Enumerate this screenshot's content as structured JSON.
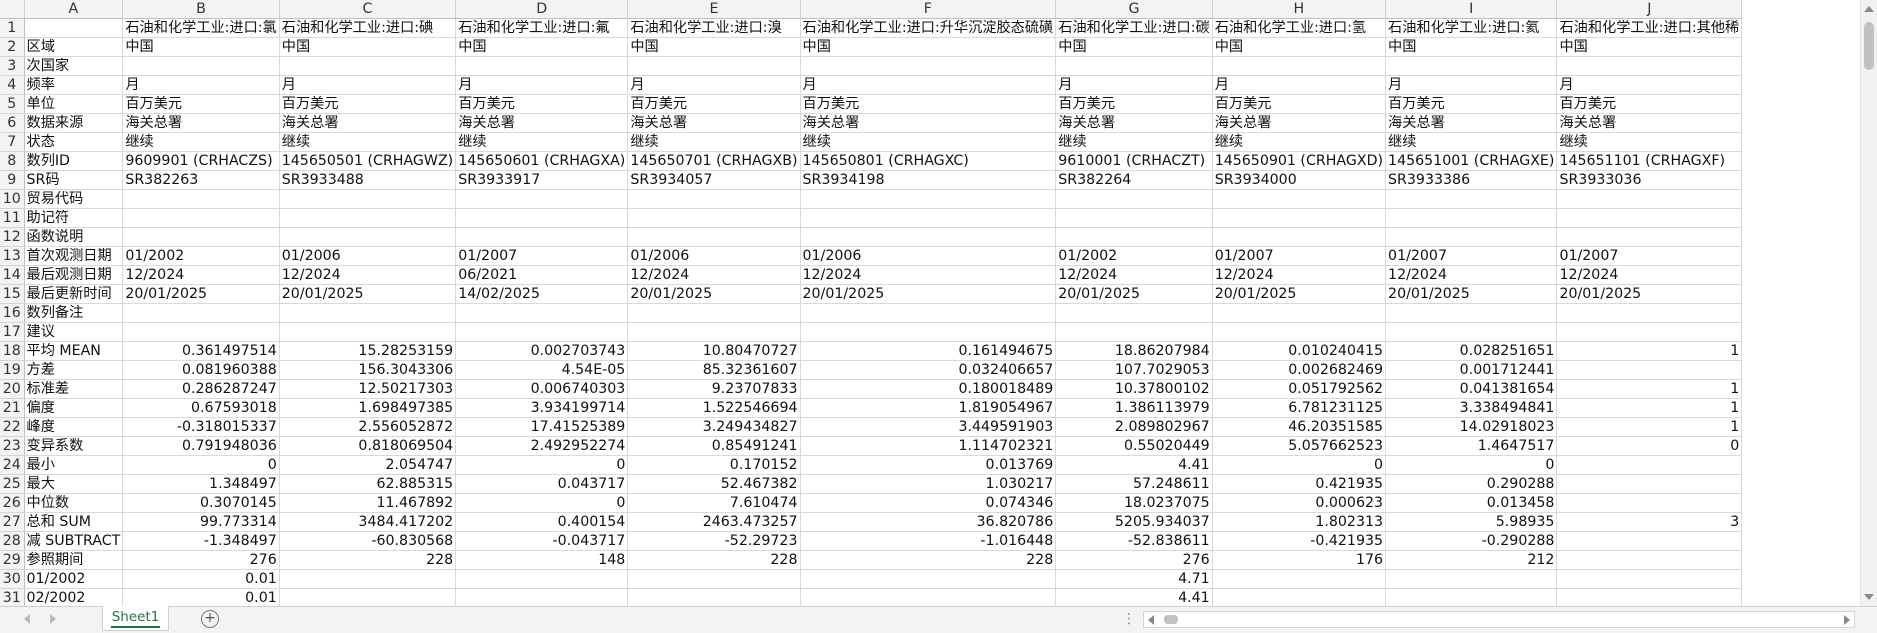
{
  "columns": [
    "A",
    "B",
    "C",
    "D",
    "E",
    "F",
    "G",
    "H",
    "I",
    "J"
  ],
  "rows": [
    {
      "n": "1",
      "cells": [
        "",
        "石油和化学工业:进口:氯",
        "石油和化学工业:进口:碘",
        "石油和化学工业:进口:氟",
        "石油和化学工业:进口:溴",
        "石油和化学工业:进口:升华沉淀胶态硫磺",
        "石油和化学工业:进口:碳",
        "石油和化学工业:进口:氢",
        "石油和化学工业:进口:氦",
        "石油和化学工业:进口:其他稀"
      ]
    },
    {
      "n": "2",
      "cells": [
        "区域",
        "中国",
        "中国",
        "中国",
        "中国",
        "中国",
        "中国",
        "中国",
        "中国",
        "中国"
      ]
    },
    {
      "n": "3",
      "cells": [
        "次国家",
        "",
        "",
        "",
        "",
        "",
        "",
        "",
        "",
        ""
      ]
    },
    {
      "n": "4",
      "cells": [
        "频率",
        "月",
        "月",
        "月",
        "月",
        "月",
        "月",
        "月",
        "月",
        "月"
      ]
    },
    {
      "n": "5",
      "cells": [
        "单位",
        "百万美元",
        "百万美元",
        "百万美元",
        "百万美元",
        "百万美元",
        "百万美元",
        "百万美元",
        "百万美元",
        "百万美元"
      ]
    },
    {
      "n": "6",
      "cells": [
        "数据来源",
        "海关总署",
        "海关总署",
        "海关总署",
        "海关总署",
        "海关总署",
        "海关总署",
        "海关总署",
        "海关总署",
        "海关总署"
      ]
    },
    {
      "n": "7",
      "cells": [
        "状态",
        "继续",
        "继续",
        "继续",
        "继续",
        "继续",
        "继续",
        "继续",
        "继续",
        "继续"
      ]
    },
    {
      "n": "8",
      "cells": [
        "数列ID",
        "9609901 (CRHACZS)",
        "145650501 (CRHAGWZ)",
        "145650601 (CRHAGXA)",
        "145650701 (CRHAGXB)",
        "145650801 (CRHAGXC)",
        "9610001 (CRHACZT)",
        "145650901 (CRHAGXD)",
        "145651001 (CRHAGXE)",
        "145651101 (CRHAGXF)"
      ]
    },
    {
      "n": "9",
      "cells": [
        "SR码",
        "SR382263",
        "SR3933488",
        "SR3933917",
        "SR3934057",
        "SR3934198",
        "SR382264",
        "SR3934000",
        "SR3933386",
        "SR3933036"
      ]
    },
    {
      "n": "10",
      "cells": [
        "贸易代码",
        "",
        "",
        "",
        "",
        "",
        "",
        "",
        "",
        ""
      ]
    },
    {
      "n": "11",
      "cells": [
        "助记符",
        "",
        "",
        "",
        "",
        "",
        "",
        "",
        "",
        ""
      ]
    },
    {
      "n": "12",
      "cells": [
        "函数说明",
        "",
        "",
        "",
        "",
        "",
        "",
        "",
        "",
        ""
      ]
    },
    {
      "n": "13",
      "cells": [
        "首次观测日期",
        "01/2002",
        "01/2006",
        "01/2007",
        "01/2006",
        "01/2006",
        "01/2002",
        "01/2007",
        "01/2007",
        "01/2007"
      ]
    },
    {
      "n": "14",
      "cells": [
        "最后观测日期",
        "12/2024",
        "12/2024",
        "06/2021",
        "12/2024",
        "12/2024",
        "12/2024",
        "12/2024",
        "12/2024",
        "12/2024"
      ]
    },
    {
      "n": "15",
      "cells": [
        "最后更新时间",
        "20/01/2025",
        "20/01/2025",
        "14/02/2025",
        "20/01/2025",
        "20/01/2025",
        "20/01/2025",
        "20/01/2025",
        "20/01/2025",
        "20/01/2025"
      ]
    },
    {
      "n": "16",
      "cells": [
        "数列备注",
        "",
        "",
        "",
        "",
        "",
        "",
        "",
        "",
        ""
      ]
    },
    {
      "n": "17",
      "cells": [
        "建议",
        "",
        "",
        "",
        "",
        "",
        "",
        "",
        "",
        ""
      ]
    },
    {
      "n": "18",
      "cells": [
        "平均 MEAN",
        "0.361497514",
        "15.28253159",
        "0.002703743",
        "10.80470727",
        "0.161494675",
        "18.86207984",
        "0.010240415",
        "0.028251651",
        "1"
      ]
    },
    {
      "n": "19",
      "cells": [
        "方差",
        "0.081960388",
        "156.3043306",
        "4.54E-05",
        "85.32361607",
        "0.032406657",
        "107.7029053",
        "0.002682469",
        "0.001712441",
        ""
      ]
    },
    {
      "n": "20",
      "cells": [
        "标准差",
        "0.286287247",
        "12.50217303",
        "0.006740303",
        "9.23707833",
        "0.180018489",
        "10.37800102",
        "0.051792562",
        "0.041381654",
        "1"
      ]
    },
    {
      "n": "21",
      "cells": [
        "偏度",
        "0.67593018",
        "1.698497385",
        "3.934199714",
        "1.522546694",
        "1.819054967",
        "1.386113979",
        "6.781231125",
        "3.338494841",
        "1"
      ]
    },
    {
      "n": "22",
      "cells": [
        "峰度",
        "-0.318015337",
        "2.556052872",
        "17.41525389",
        "3.249434827",
        "3.449591903",
        "2.089802967",
        "46.20351585",
        "14.02918023",
        "1"
      ]
    },
    {
      "n": "23",
      "cells": [
        "变异系数",
        "0.791948036",
        "0.818069504",
        "2.492952274",
        "0.85491241",
        "1.114702321",
        "0.55020449",
        "5.057662523",
        "1.4647517",
        "0"
      ]
    },
    {
      "n": "24",
      "cells": [
        "最小",
        "0",
        "2.054747",
        "0",
        "0.170152",
        "0.013769",
        "4.41",
        "0",
        "0",
        ""
      ]
    },
    {
      "n": "25",
      "cells": [
        "最大",
        "1.348497",
        "62.885315",
        "0.043717",
        "52.467382",
        "1.030217",
        "57.248611",
        "0.421935",
        "0.290288",
        ""
      ]
    },
    {
      "n": "26",
      "cells": [
        "中位数",
        "0.3070145",
        "11.467892",
        "0",
        "7.610474",
        "0.074346",
        "18.0237075",
        "0.000623",
        "0.013458",
        ""
      ]
    },
    {
      "n": "27",
      "cells": [
        "总和 SUM",
        "99.773314",
        "3484.417202",
        "0.400154",
        "2463.473257",
        "36.820786",
        "5205.934037",
        "1.802313",
        "5.98935",
        "3"
      ]
    },
    {
      "n": "28",
      "cells": [
        "减 SUBTRACT",
        "-1.348497",
        "-60.830568",
        "-0.043717",
        "-52.29723",
        "-1.016448",
        "-52.838611",
        "-0.421935",
        "-0.290288",
        ""
      ]
    },
    {
      "n": "29",
      "cells": [
        "参照期间",
        "276",
        "228",
        "148",
        "228",
        "228",
        "276",
        "176",
        "212",
        ""
      ]
    },
    {
      "n": "30",
      "cells": [
        "01/2002",
        "0.01",
        "",
        "",
        "",
        "",
        "4.71",
        "",
        "",
        ""
      ]
    },
    {
      "n": "31",
      "cells": [
        "02/2002",
        "0.01",
        "",
        "",
        "",
        "",
        "4.41",
        "",
        "",
        ""
      ]
    }
  ],
  "sheet_tab_label": "Sheet1",
  "icons": {
    "add_sheet": "plus-circle-icon",
    "nav_prev": "triangle-left-icon",
    "nav_next": "triangle-right-icon",
    "more": "ellipsis-icon"
  },
  "colors": {
    "accent": "#217346",
    "header_bg": "#f3f3f3",
    "grid_line": "#d9d9d9"
  }
}
